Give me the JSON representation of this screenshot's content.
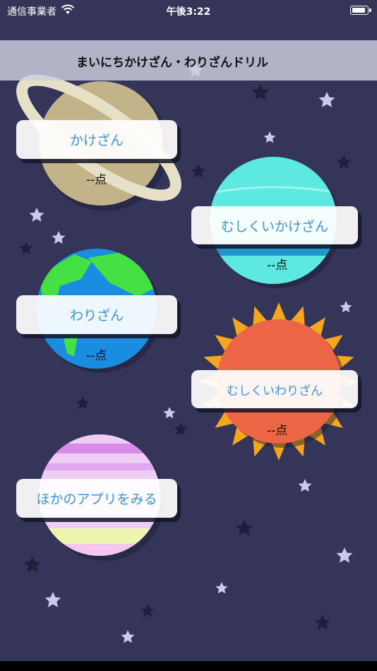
{
  "status_bar": {
    "carrier": "通信事業者",
    "time": "午後3:22"
  },
  "header": {
    "title": "まいにちかけざん・わりざんドリル"
  },
  "menu": {
    "multiplication": {
      "label": "かけざん",
      "score": "--点"
    },
    "hard_multiplication": {
      "label": "むしくいかけざん",
      "score": "--点"
    },
    "division": {
      "label": "わりざん",
      "score": "--点"
    },
    "hard_division": {
      "label": "むしくいわりざん",
      "score": "--点"
    },
    "other_apps": {
      "label": "ほかのアプリをみる"
    }
  },
  "colors": {
    "background": "#35355a",
    "accent_text": "#3d92d8",
    "saturn": "#c2b488",
    "uranus": "#5ee8e2",
    "earth_ocean": "#1a8de0",
    "earth_land": "#44e044",
    "sun": "#ec6544",
    "sun_rays": "#f4a61c",
    "pastel_planet": "#f0cdf4"
  }
}
